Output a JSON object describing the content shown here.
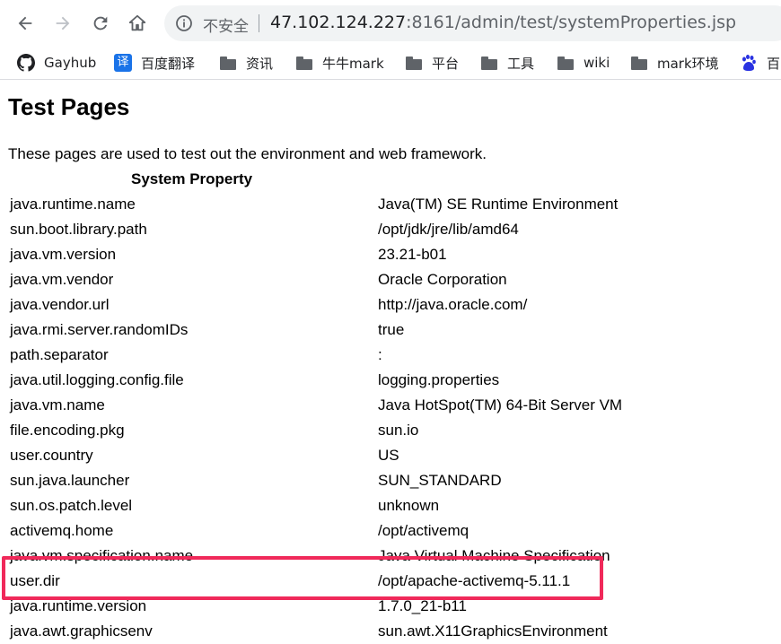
{
  "browser": {
    "security_label": "不安全",
    "url_host": "47.102.124.227",
    "url_rest": ":8161/admin/test/systemProperties.jsp"
  },
  "bookmarks": [
    {
      "label": "Gayhub",
      "icon": "github-icon"
    },
    {
      "label": "百度翻译",
      "icon": "translate-icon",
      "icon_glyph": "译"
    },
    {
      "label": "资讯",
      "icon": "folder-icon"
    },
    {
      "label": "牛牛mark",
      "icon": "folder-icon"
    },
    {
      "label": "平台",
      "icon": "folder-icon"
    },
    {
      "label": "工具",
      "icon": "folder-icon"
    },
    {
      "label": "wiki",
      "icon": "folder-icon"
    },
    {
      "label": "mark环境",
      "icon": "folder-icon"
    },
    {
      "label": "百",
      "icon": "baidu-paw-icon"
    }
  ],
  "page": {
    "title": "Test Pages",
    "description": "These pages are used to test out the environment and web framework.",
    "table_header": "System Property",
    "properties": [
      {
        "name": "java.runtime.name",
        "value": "Java(TM) SE Runtime Environment"
      },
      {
        "name": "sun.boot.library.path",
        "value": "/opt/jdk/jre/lib/amd64"
      },
      {
        "name": "java.vm.version",
        "value": "23.21-b01"
      },
      {
        "name": "java.vm.vendor",
        "value": "Oracle Corporation"
      },
      {
        "name": "java.vendor.url",
        "value": "http://java.oracle.com/"
      },
      {
        "name": "java.rmi.server.randomIDs",
        "value": "true"
      },
      {
        "name": "path.separator",
        "value": ":"
      },
      {
        "name": "java.util.logging.config.file",
        "value": "logging.properties"
      },
      {
        "name": "java.vm.name",
        "value": "Java HotSpot(TM) 64-Bit Server VM"
      },
      {
        "name": "file.encoding.pkg",
        "value": "sun.io"
      },
      {
        "name": "user.country",
        "value": "US"
      },
      {
        "name": "sun.java.launcher",
        "value": "SUN_STANDARD"
      },
      {
        "name": "sun.os.patch.level",
        "value": "unknown"
      },
      {
        "name": "activemq.home",
        "value": "/opt/activemq"
      },
      {
        "name": "java.vm.specification.name",
        "value": "Java Virtual Machine Specification"
      },
      {
        "name": "user.dir",
        "value": "/opt/apache-activemq-5.11.1"
      },
      {
        "name": "java.runtime.version",
        "value": "1.7.0_21-b11"
      },
      {
        "name": "java.awt.graphicsenv",
        "value": "sun.awt.X11GraphicsEnvironment"
      }
    ]
  },
  "colors": {
    "highlight": "#f0295a",
    "omnibox_bg": "#f1f3f4",
    "icon_gray": "#5f6368",
    "translate_blue": "#1a73e8",
    "baidu_blue": "#2932e1"
  }
}
